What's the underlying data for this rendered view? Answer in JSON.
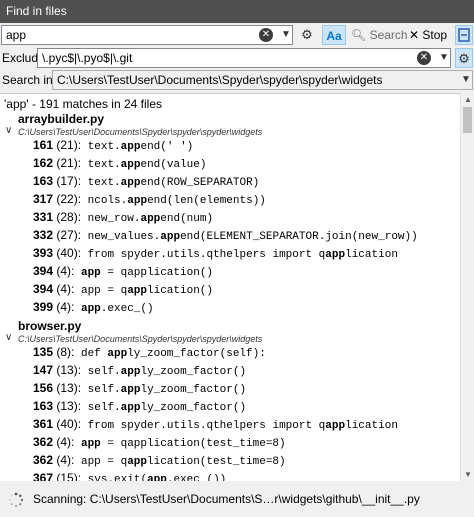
{
  "window": {
    "title": "Find in files"
  },
  "search": {
    "value": "app",
    "case_label": "Aa",
    "search_label": "Search",
    "stop_label": "Stop"
  },
  "exclude": {
    "label": "Exclude:",
    "value": "\\.pyc$|\\.pyo$|\\.git"
  },
  "search_in": {
    "label": "Search in:",
    "value": "C:\\Users\\TestUser\\Documents\\Spyder\\spyder\\spyder\\widgets"
  },
  "results": {
    "summary": "'app' - 191 matches in 24 files",
    "files": [
      {
        "name": "arraybuilder.py",
        "path": "C:\\Users\\TestUser\\Documents\\Spyder\\spyder\\spyder\\widgets",
        "matches": [
          {
            "line": "161",
            "col": " (21):",
            "pre": " text.",
            "hit": "app",
            "post": "end(' ')"
          },
          {
            "line": "162",
            "col": " (21):",
            "pre": " text.",
            "hit": "app",
            "post": "end(value)"
          },
          {
            "line": "163",
            "col": " (17):",
            "pre": " text.",
            "hit": "app",
            "post": "end(ROW_SEPARATOR)"
          },
          {
            "line": "317",
            "col": " (22):",
            "pre": " ncols.",
            "hit": "app",
            "post": "end(len(elements))"
          },
          {
            "line": "331",
            "col": " (28):",
            "pre": " new_row.",
            "hit": "app",
            "post": "end(num)"
          },
          {
            "line": "332",
            "col": " (27):",
            "pre": " new_values.",
            "hit": "app",
            "post": "end(ELEMENT_SEPARATOR.join(new_row))"
          },
          {
            "line": "393",
            "col": " (40):",
            "pre": " from spyder.utils.qthelpers import q",
            "hit": "app",
            "post": "lication"
          },
          {
            "line": "394",
            "col": " (4):",
            "pre": " ",
            "hit": "app",
            "post": " = qapplication()"
          },
          {
            "line": "394",
            "col": " (4):",
            "pre": " app = q",
            "hit": "app",
            "post": "lication()"
          },
          {
            "line": "399",
            "col": " (4):",
            "pre": " ",
            "hit": "app",
            "post": ".exec_()"
          }
        ]
      },
      {
        "name": "browser.py",
        "path": "C:\\Users\\TestUser\\Documents\\Spyder\\spyder\\spyder\\widgets",
        "matches": [
          {
            "line": "135",
            "col": " (8):",
            "pre": " def ",
            "hit": "app",
            "post": "ly_zoom_factor(self):"
          },
          {
            "line": "147",
            "col": " (13):",
            "pre": " self.",
            "hit": "app",
            "post": "ly_zoom_factor()"
          },
          {
            "line": "156",
            "col": " (13):",
            "pre": " self.",
            "hit": "app",
            "post": "ly_zoom_factor()"
          },
          {
            "line": "163",
            "col": " (13):",
            "pre": " self.",
            "hit": "app",
            "post": "ly_zoom_factor()"
          },
          {
            "line": "361",
            "col": " (40):",
            "pre": " from spyder.utils.qthelpers import q",
            "hit": "app",
            "post": "lication"
          },
          {
            "line": "362",
            "col": " (4):",
            "pre": " ",
            "hit": "app",
            "post": " = qapplication(test_time=8)"
          },
          {
            "line": "362",
            "col": " (4):",
            "pre": " app = q",
            "hit": "app",
            "post": "lication(test_time=8)"
          },
          {
            "line": "367",
            "col": " (15):",
            "pre": " sys.exit(",
            "hit": "app",
            "post": ".exec_())"
          }
        ]
      }
    ]
  },
  "status": {
    "text": "Scanning: C:\\Users\\TestUser\\Documents\\S…r\\widgets\\github\\__init__.py"
  },
  "colors": {
    "titlebar": "#505050",
    "accent": "#0078d7",
    "case_button_bg": "#cce4f7"
  }
}
